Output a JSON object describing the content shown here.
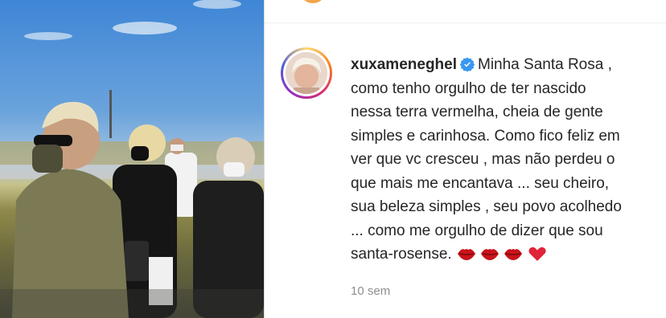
{
  "post": {
    "username": "xuxameneghel",
    "verified": true,
    "caption_lines": [
      "Minha Santa Rosa ,",
      "como tenho orgulho de ter nascido",
      "nessa terra vermelha, cheia de gente",
      "simples e carinhosa. Como fico feliz em",
      "ver que vc cresceu , mas não perdeu o",
      "que mais me encantava ... seu cheiro,",
      "sua beleza simples , seu povo acolhedo",
      "... como me orgulho de dizer que sou",
      "santa-rosense."
    ],
    "emojis": [
      "lips-icon",
      "lips-icon",
      "lips-icon",
      "red-heart-icon"
    ],
    "timestamp": "10 sem"
  },
  "colors": {
    "text": "#262626",
    "muted": "#8e8e8e",
    "verified_blue": "#3897f0",
    "heart_red": "#e0243a",
    "lips_red": "#c8141b"
  }
}
